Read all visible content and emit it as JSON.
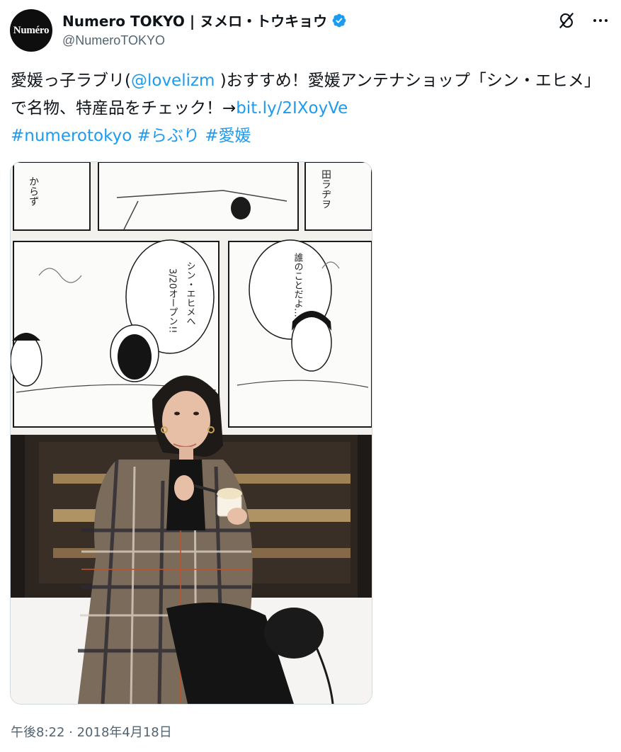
{
  "author": {
    "avatar_text": "Numéro",
    "display_name": "Numero TOKYO | ヌメロ・トウキョウ",
    "handle": "@NumeroTOKYO",
    "verified_color": "#1d9bf0"
  },
  "header_icons": [
    "grok-icon",
    "more-icon"
  ],
  "tweet": {
    "text_part1": "愛媛っ子ラブリ(",
    "mention": "@lovelizm",
    "text_part2": " )おすすめ！愛媛アンテナショップ「シン・エヒメ」で名物、特産品をチェック！→",
    "link": "bit.ly/2IXoyVe",
    "hashtags": [
      "#numerotokyo",
      "#らぶり",
      "#愛媛"
    ],
    "link_color": "#1d9bf0"
  },
  "media": {
    "comic_texts": [
      "からず",
      "田ラヂヲ",
      "シン・エヒメへ",
      "3/20オープン!!",
      "誰のことだよ…？"
    ]
  },
  "timestamp": "午後8:22 · 2018年4月18日"
}
